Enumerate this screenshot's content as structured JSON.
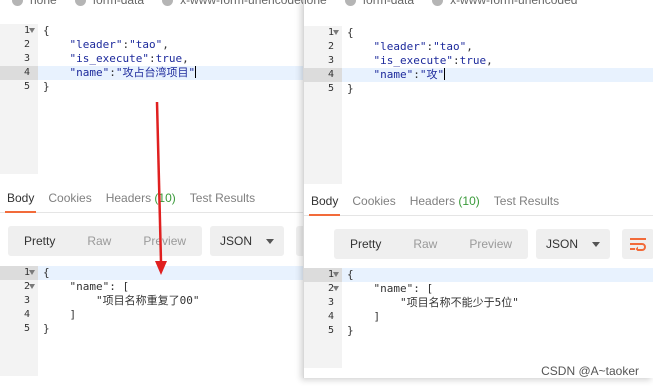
{
  "body_types": [
    {
      "label": "none"
    },
    {
      "label": "form-data"
    },
    {
      "label": "x-www-form-urlencoded"
    }
  ],
  "left": {
    "request_lines": [
      {
        "num": "1",
        "fold": true,
        "text": "{"
      },
      {
        "num": "2",
        "fold": false,
        "key": "\"leader\"",
        "sep": ":",
        "value": "\"tao\"",
        "tail": ","
      },
      {
        "num": "3",
        "fold": false,
        "key": "\"is_execute\"",
        "sep": ":",
        "value": "true",
        "tail": ","
      },
      {
        "num": "4",
        "fold": false,
        "key": "\"name\"",
        "sep": ":",
        "value": "\"攻占台湾项目\"",
        "tail": ""
      },
      {
        "num": "5",
        "fold": false,
        "text": "}"
      }
    ],
    "tabs": [
      {
        "label": "Body",
        "active": true
      },
      {
        "label": "Cookies"
      },
      {
        "label": "Headers",
        "count": "(10)"
      },
      {
        "label": "Test Results"
      }
    ],
    "view_modes": [
      "Pretty",
      "Raw",
      "Preview"
    ],
    "format": "JSON",
    "response_lines": [
      {
        "num": "1",
        "fold": true,
        "text": "{"
      },
      {
        "num": "2",
        "fold": true,
        "text": "    \"name\": ["
      },
      {
        "num": "3",
        "fold": false,
        "text": "        \"项目名称重复了00\""
      },
      {
        "num": "4",
        "fold": false,
        "text": "    ]"
      },
      {
        "num": "5",
        "fold": false,
        "text": "}"
      }
    ]
  },
  "right": {
    "body_types": [
      {
        "label": "none"
      },
      {
        "label": "form-data"
      },
      {
        "label": "x-www-form-urlencoded"
      }
    ],
    "request_lines": [
      {
        "num": "1",
        "fold": true,
        "text": "{"
      },
      {
        "num": "2",
        "fold": false,
        "key": "\"leader\"",
        "sep": ":",
        "value": "\"tao\"",
        "tail": ","
      },
      {
        "num": "3",
        "fold": false,
        "key": "\"is_execute\"",
        "sep": ":",
        "value": "true",
        "tail": ","
      },
      {
        "num": "4",
        "fold": false,
        "key": "\"name\"",
        "sep": ":",
        "value": "\"攻\"",
        "tail": ""
      },
      {
        "num": "5",
        "fold": false,
        "text": "}"
      }
    ],
    "tabs": [
      {
        "label": "Body",
        "active": true
      },
      {
        "label": "Cookies"
      },
      {
        "label": "Headers",
        "count": "(10)"
      },
      {
        "label": "Test Results"
      }
    ],
    "view_modes": [
      "Pretty",
      "Raw",
      "Preview"
    ],
    "format": "JSON",
    "response_lines": [
      {
        "num": "1",
        "fold": true,
        "text": "{"
      },
      {
        "num": "2",
        "fold": true,
        "text": "    \"name\": ["
      },
      {
        "num": "3",
        "fold": false,
        "text": "        \"项目名称不能少于5位\""
      },
      {
        "num": "4",
        "fold": false,
        "text": "    ]"
      },
      {
        "num": "5",
        "fold": false,
        "text": "}"
      }
    ]
  },
  "watermark": "CSDN @A~taoker",
  "colors": {
    "accent": "#f26b3a",
    "arrow": "#e02020",
    "count": "#3a9a3a"
  }
}
